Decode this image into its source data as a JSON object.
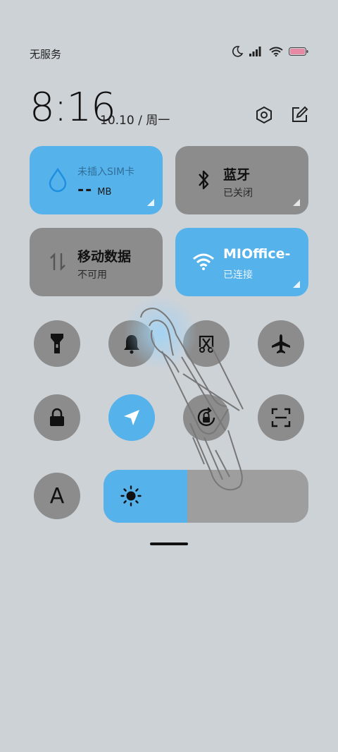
{
  "status": {
    "carrier": "无服务"
  },
  "clock": {
    "time": "8:16",
    "date": "10.10 / 周一"
  },
  "tiles": {
    "sim": {
      "title": "未插入SIM卡",
      "value": "--",
      "unit": "MB",
      "state": "on"
    },
    "bluetooth": {
      "title": "蓝牙",
      "subtitle": "已关闭",
      "state": "off"
    },
    "mobile_data": {
      "title": "移动数据",
      "subtitle": "不可用",
      "state": "off"
    },
    "wifi": {
      "title": "MIOffice-",
      "subtitle": "已连接",
      "state": "on"
    }
  },
  "toggles": [
    {
      "name": "flashlight",
      "icon": "flashlight-icon",
      "active": false
    },
    {
      "name": "bell",
      "icon": "bell-icon",
      "active": false
    },
    {
      "name": "screenshot",
      "icon": "scissors-icon",
      "active": false
    },
    {
      "name": "airplane",
      "icon": "airplane-icon",
      "active": false
    },
    {
      "name": "lock",
      "icon": "lock-icon",
      "active": false
    },
    {
      "name": "location",
      "icon": "location-arrow-icon",
      "active": true
    },
    {
      "name": "rotation-lock",
      "icon": "rotation-lock-icon",
      "active": false
    },
    {
      "name": "scanner",
      "icon": "scan-icon",
      "active": false
    }
  ],
  "font_toggle": {
    "label": "A"
  },
  "brightness": {
    "level": 0.41
  },
  "colors": {
    "accent": "#56b2ea",
    "inactive": "#8c8c8c",
    "background": "#cdd2d7"
  }
}
